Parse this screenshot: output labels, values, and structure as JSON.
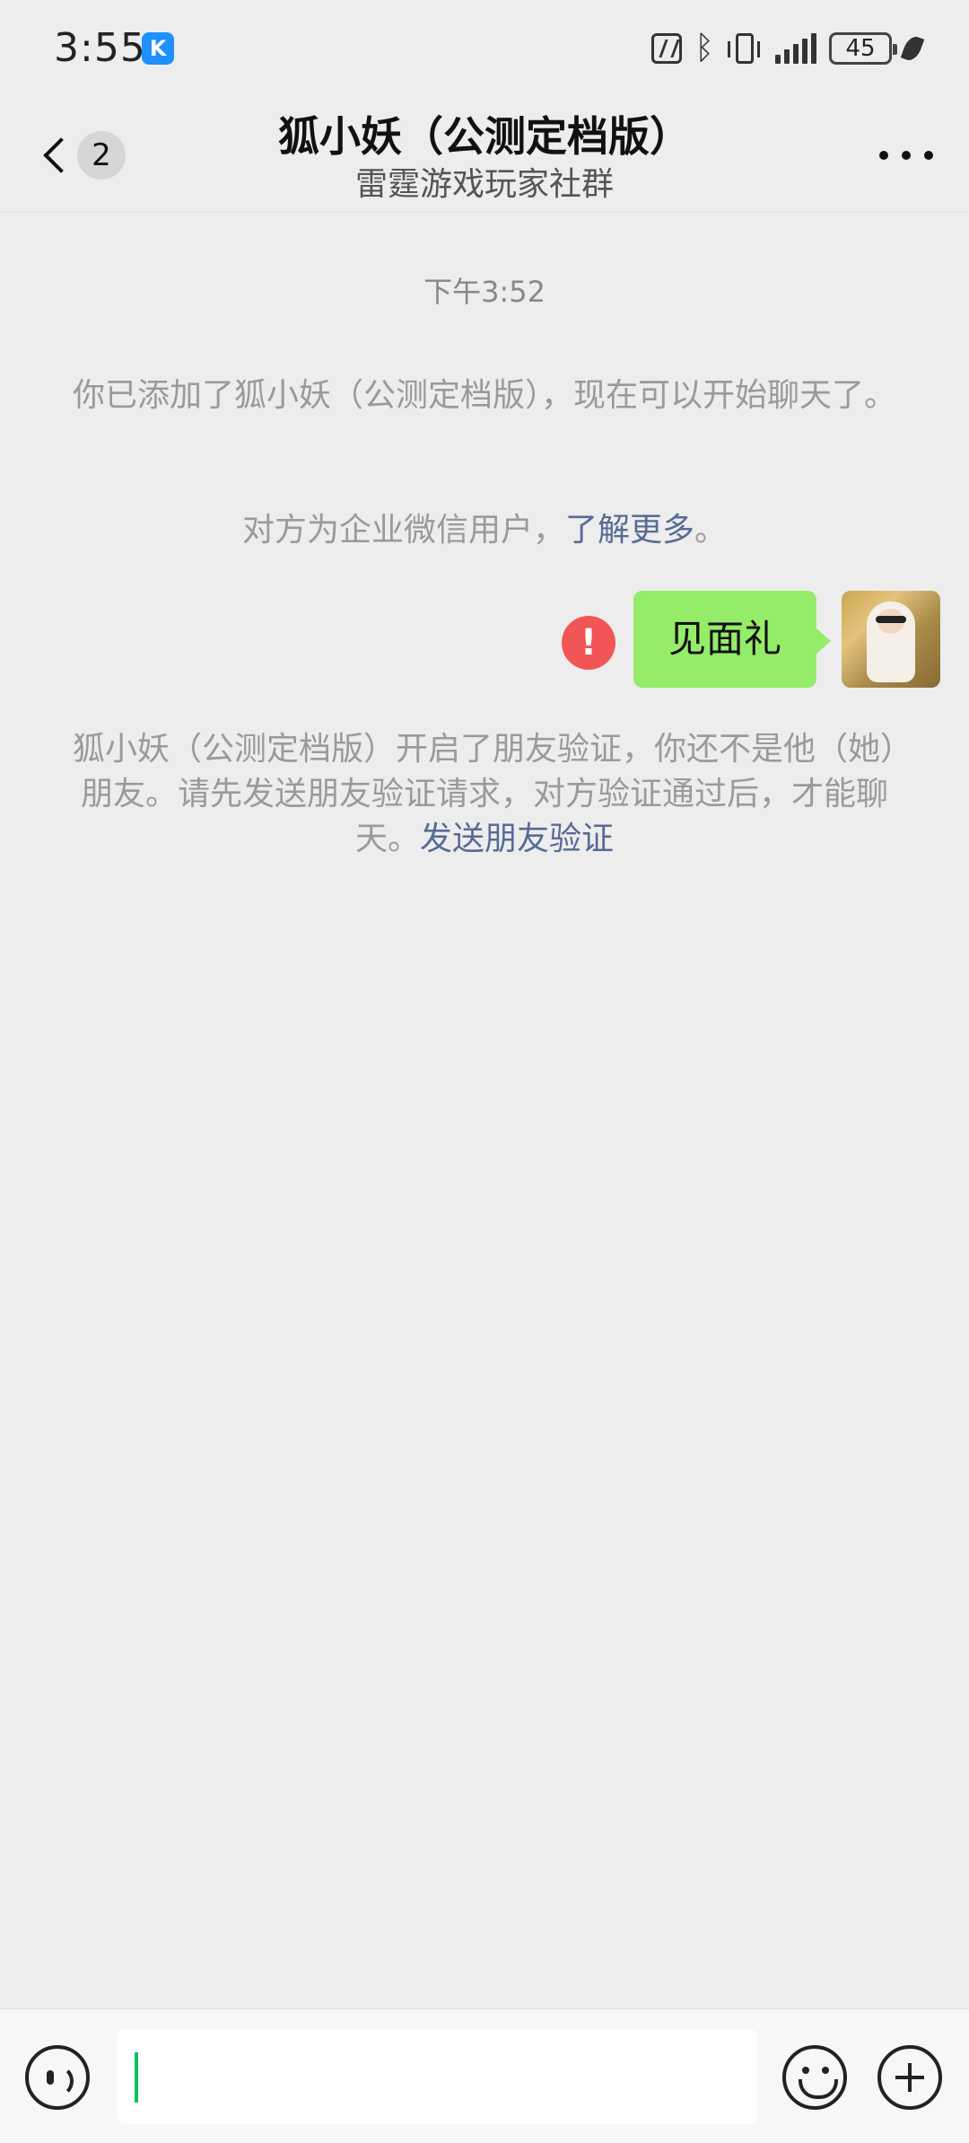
{
  "status_bar": {
    "time": "3:55",
    "app_badge": "K",
    "battery": "45",
    "bluetooth_glyph": "ᛒ",
    "icons": [
      "nfc-icon",
      "bluetooth-icon",
      "vibrate-icon",
      "signal-icon",
      "battery-icon",
      "leaf-icon"
    ]
  },
  "nav": {
    "unread_count": "2",
    "title": "狐小妖（公测定档版）",
    "subtitle": "雷霆游戏玩家社群"
  },
  "chat": {
    "timestamp": "下午3:52",
    "system_added": "你已添加了狐小妖（公测定档版），现在可以开始聊天了。",
    "enterprise_notice": "对方为企业微信用户，",
    "enterprise_link": "了解更多",
    "enterprise_suffix": "。",
    "outgoing_message": "见面礼",
    "fail_mark": "!",
    "verify_notice": "狐小妖（公测定档版）开启了朋友验证，你还不是他（她）朋友。请先发送朋友验证请求，对方验证通过后，才能聊天。",
    "verify_link": "发送朋友验证"
  },
  "colors": {
    "bubble_green": "#95ec69",
    "link_blue": "#576b95",
    "error_red": "#f25555",
    "caret_green": "#07c160"
  }
}
